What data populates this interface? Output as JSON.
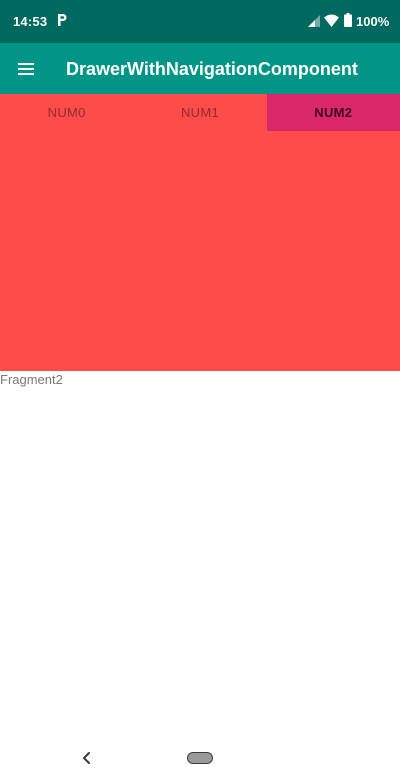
{
  "status_bar": {
    "time": "14:53",
    "battery": "100%",
    "icons": [
      "parking-icon",
      "signal-icon",
      "wifi-icon",
      "battery-icon"
    ]
  },
  "app_bar": {
    "title": "DrawerWithNavigationComponent",
    "menu_icon": "hamburger-menu-icon"
  },
  "tabs": [
    {
      "label": "NUM0",
      "selected": false
    },
    {
      "label": "NUM1",
      "selected": false
    },
    {
      "label": "NUM2",
      "selected": true
    }
  ],
  "content": {
    "fragment_label": "Fragment2"
  },
  "nav_bar": {
    "icons": [
      "back-icon",
      "home-pill-icon"
    ]
  },
  "colors": {
    "status_bar": "#00695f",
    "app_bar": "#009586",
    "tab_background": "#fe4c4a",
    "tab_selected": "#d9276a",
    "content_panel": "#fe4c4a"
  }
}
